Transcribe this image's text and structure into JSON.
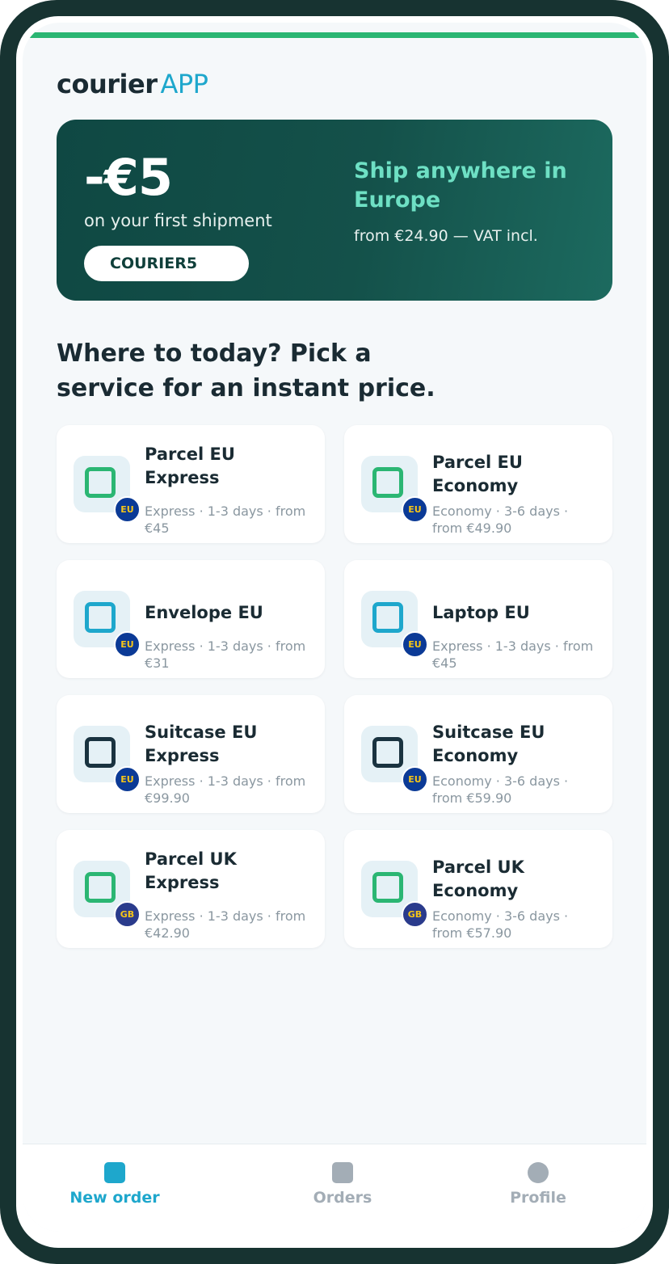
{
  "brand": {
    "part1": "courier",
    "part2": "APP"
  },
  "promo": {
    "amount": "-€5",
    "subtitle": "on your first shipment",
    "code": "COURIER5",
    "headline": "Ship anywhere in Europe",
    "price": "from €24.90 — VAT incl."
  },
  "heading": "Where to today? Pick a service for an instant price.",
  "services": [
    {
      "title": "Parcel EU Express",
      "meta": "Express · 1-3 days · from €45",
      "badge": "EU",
      "icon_color": "#2bb673"
    },
    {
      "title": "Parcel EU Economy",
      "meta": "Economy · 3-6 days · from €49.90",
      "badge": "EU",
      "icon_color": "#2bb673"
    },
    {
      "title": "Envelope EU",
      "meta": "Express · 1-3 days · from €31",
      "badge": "EU",
      "icon_color": "#1ea7cc"
    },
    {
      "title": "Laptop EU",
      "meta": "Express · 1-3 days · from €45",
      "badge": "EU",
      "icon_color": "#1ea7cc"
    },
    {
      "title": "Suitcase EU Express",
      "meta": "Express · 1-3 days · from €99.90",
      "badge": "EU",
      "icon_color": "#1a3340"
    },
    {
      "title": "Suitcase EU Economy",
      "meta": "Economy · 3-6 days · from €59.90",
      "badge": "EU",
      "icon_color": "#1a3340"
    },
    {
      "title": "Parcel UK Express",
      "meta": "Express · 1-3 days · from €42.90",
      "badge": "GB",
      "icon_color": "#2bb673"
    },
    {
      "title": "Parcel UK Economy",
      "meta": "Economy · 3-6 days · from €57.90",
      "badge": "GB",
      "icon_color": "#2bb673"
    }
  ],
  "tabs": [
    {
      "label": "New order",
      "icon": "new-order-icon",
      "active": true
    },
    {
      "label": "Orders",
      "icon": "orders-icon",
      "active": false
    },
    {
      "label": "Profile",
      "icon": "profile-icon",
      "active": false
    }
  ],
  "colors": {
    "accent": "#1ea7cc",
    "brand_green": "#2bb673",
    "promo_bg": "#0f4843",
    "promo_headline": "#6ee0c4",
    "inactive": "#a3adb6"
  }
}
